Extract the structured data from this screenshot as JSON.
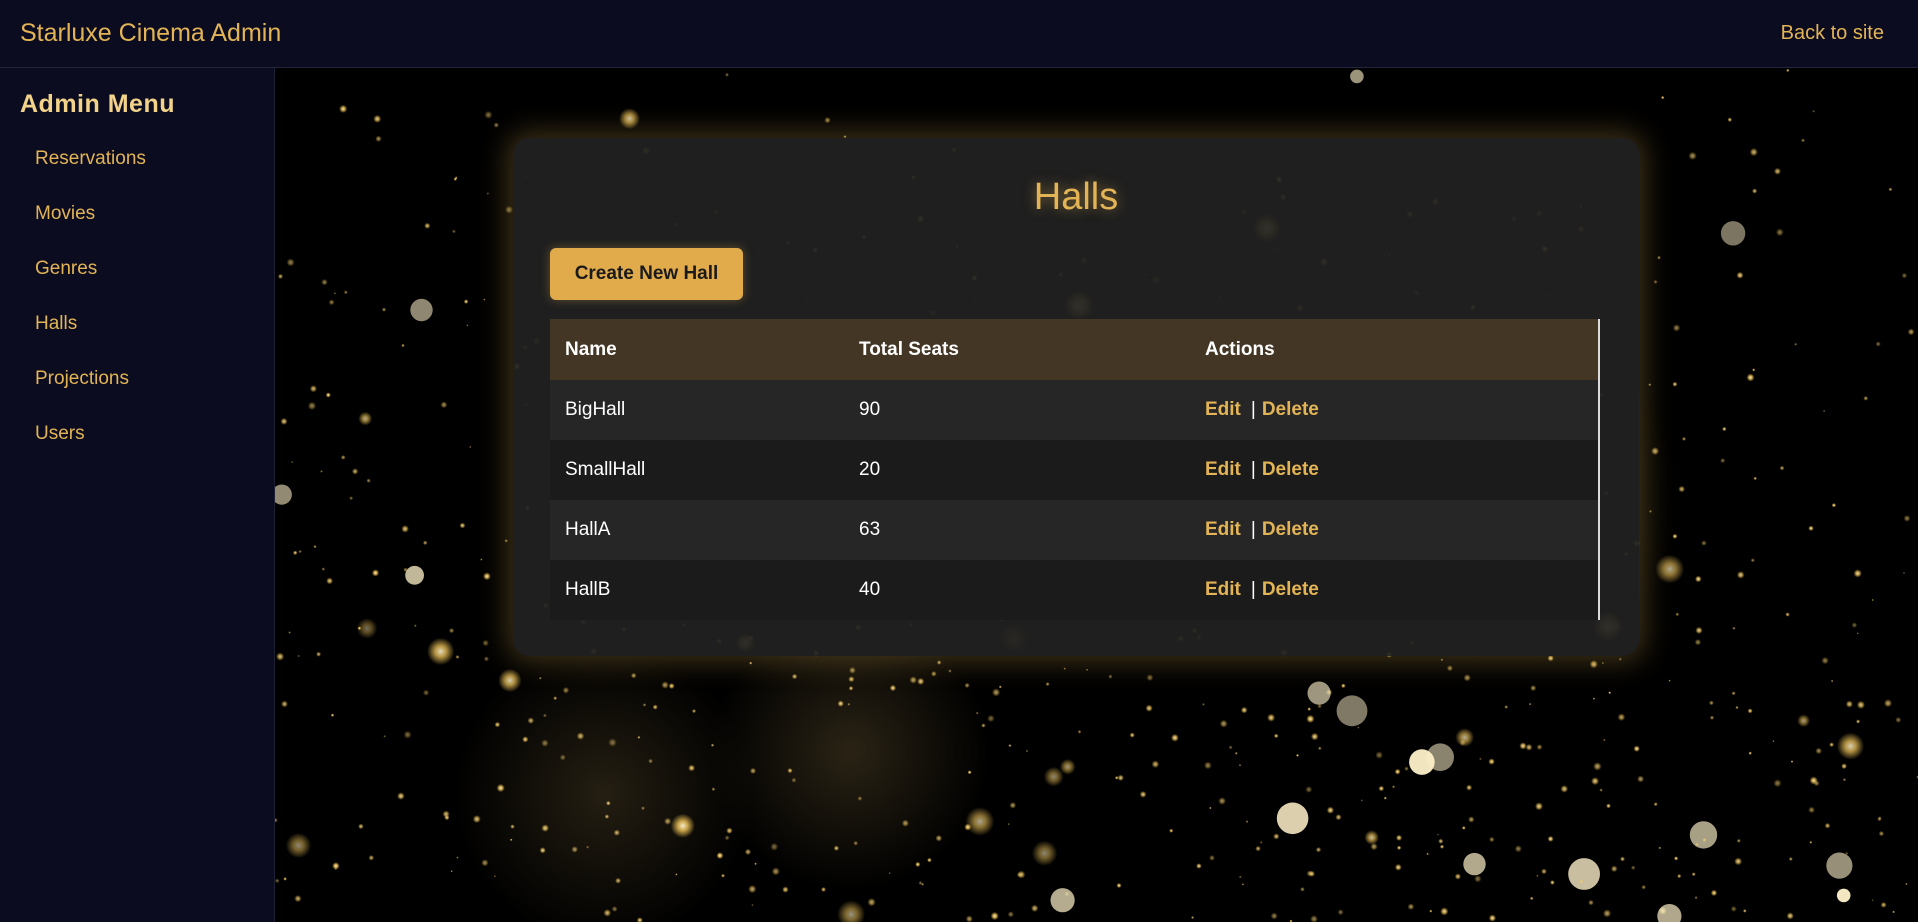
{
  "header": {
    "brand": "Starluxe Cinema Admin",
    "back_link": "Back to site"
  },
  "sidebar": {
    "title": "Admin Menu",
    "items": [
      {
        "label": "Reservations"
      },
      {
        "label": "Movies"
      },
      {
        "label": "Genres"
      },
      {
        "label": "Halls"
      },
      {
        "label": "Projections"
      },
      {
        "label": "Users"
      }
    ]
  },
  "main": {
    "title": "Halls",
    "create_button": "Create New Hall",
    "table": {
      "headers": [
        "Name",
        "Total Seats",
        "Actions"
      ],
      "rows": [
        {
          "name": "BigHall",
          "seats": "90",
          "edit": "Edit",
          "sep": "|",
          "delete": "Delete"
        },
        {
          "name": "SmallHall",
          "seats": "20",
          "edit": "Edit",
          "sep": "|",
          "delete": "Delete"
        },
        {
          "name": "HallA",
          "seats": "63",
          "edit": "Edit",
          "sep": "|",
          "delete": "Delete"
        },
        {
          "name": "HallB",
          "seats": "40",
          "edit": "Edit",
          "sep": "|",
          "delete": "Delete"
        }
      ]
    }
  },
  "colors": {
    "accent": "#e3b455",
    "button": "#e1ab4c",
    "nav_background": "#0b0c20",
    "table_header": "#433624",
    "card": "#212121"
  }
}
